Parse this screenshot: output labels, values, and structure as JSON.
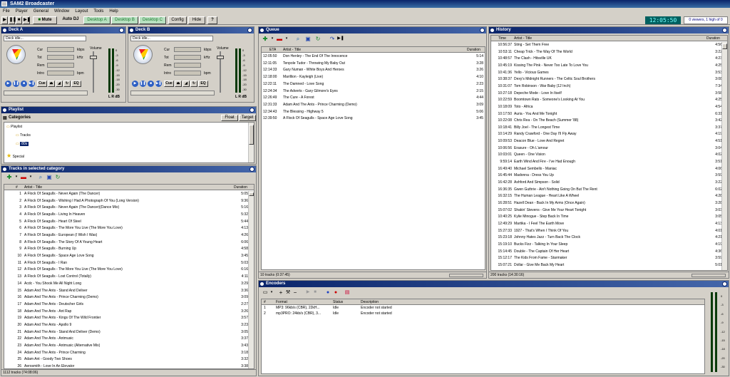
{
  "app": {
    "title": "SAM2 Broadcaster"
  },
  "menu": [
    "File",
    "Player",
    "General",
    "Window",
    "Layout",
    "Tools",
    "Help"
  ],
  "toolbar": {
    "mute": "Mute",
    "autodj": "Auto DJ",
    "desktops": [
      "Desktop A",
      "Desktop B",
      "Desktop C"
    ],
    "config": "Config",
    "hide": "Hide",
    "help": "?",
    "clock": "12:05:50",
    "viewers": "0 viewers, 1 high of 0"
  },
  "deckA": {
    "title": "Deck A",
    "status": "Deck idle...",
    "labels": [
      "Cur",
      "Tot",
      "Rem",
      "Intro"
    ],
    "units": [
      "kbps",
      "kHz",
      "",
      "bpm"
    ],
    "volume": "Volume",
    "cue": "Cue",
    "eq": "EQ",
    "meter_label": "L R dB"
  },
  "deckB": {
    "title": "Deck B",
    "status": "Deck idle...",
    "labels": [
      "Cur",
      "Tot",
      "Rem",
      "Intro"
    ],
    "units": [
      "kbps",
      "kHz",
      "",
      "bpm"
    ],
    "volume": "Volume",
    "cue": "Cue",
    "eq": "EQ",
    "meter_label": "L R dB"
  },
  "meter_scale": [
    "0",
    "-3",
    "-6",
    "-9",
    "-12",
    "-15",
    "-18",
    "-20",
    "-30"
  ],
  "playlist": {
    "title": "Playlist",
    "categories": "Categories",
    "float": "Float",
    "target": "Target",
    "tree": [
      "Playlist",
      "Tracks",
      "80s",
      "Special"
    ]
  },
  "tracks": {
    "title": "Tracks in selected category",
    "headers": {
      "num": "#",
      "title": "Artist - Title",
      "duration": "Duration"
    },
    "rows": [
      [
        "1",
        "A Flock Of Seagulls - Never Again (The Dancer)",
        "5:05"
      ],
      [
        "2",
        "A Flock Of Seagulls - Wishing I Had A Photograph Of You (Long Version)",
        "9:36"
      ],
      [
        "3",
        "A Flock Of Seagulls - Never Again (The Dancer)(Dance Mix)",
        "5:16"
      ],
      [
        "4",
        "A Flock Of Seagulls - Living In Heaven",
        "5:32"
      ],
      [
        "5",
        "A Flock Of Seagulls - Heart Of Steel",
        "5:44"
      ],
      [
        "6",
        "A Flock Of Seagulls - The More You Live (The More You Love)",
        "4:13"
      ],
      [
        "7",
        "A Flock Of Seagulls - European (I Wish I Was)",
        "4:26"
      ],
      [
        "8",
        "A Flock Of Seagulls - The Story Of A Young Heart",
        "6:06"
      ],
      [
        "9",
        "A Flock Of Seagulls - Burning Up",
        "4:58"
      ],
      [
        "10",
        "A Flock Of Seagulls - Space Age Love Song",
        "3:45"
      ],
      [
        "11",
        "A Flock Of Seagulls - I Ran",
        "5:03"
      ],
      [
        "12",
        "A Flock Of Seagulls - The More You Live (The More You Love)",
        "6:16"
      ],
      [
        "13",
        "A Flock Of Seagulls - Lost Control (Totally)",
        "4:11"
      ],
      [
        "14",
        "Acdc - You Shook Me All Night Long",
        "3:29"
      ],
      [
        "15",
        "Adam And The Ants - Stand And Deliver",
        "3:36"
      ],
      [
        "16",
        "Adam And The Ants - Prince Charming (Demo)",
        "3:09"
      ],
      [
        "17",
        "Adam And The Ants - Deutscher Girls",
        "2:27"
      ],
      [
        "18",
        "Adam And The Ants - Ant Rap",
        "3:26"
      ],
      [
        "19",
        "Adam And The Ants - Kings Of The Wild Frontier",
        "3:57"
      ],
      [
        "20",
        "Adam And The Ants - Apollo 9",
        "3:23"
      ],
      [
        "21",
        "Adam And The Ants - Stand And Deliver (Demo)",
        "3:05"
      ],
      [
        "22",
        "Adam And The Ants - Antmusic",
        "3:37"
      ],
      [
        "23",
        "Adam And The Ants - Antmusic (Alternative Mix)",
        "3:43"
      ],
      [
        "24",
        "Adam And The Ants - Prince Charming",
        "3:18"
      ],
      [
        "25",
        "Adam Ant - Goody Two Shoes",
        "3:32"
      ],
      [
        "26",
        "Aerosmith - Love In An Elevator",
        "3:38"
      ]
    ],
    "status": "1112 tracks (74:08:06)"
  },
  "queue": {
    "title": "Queue",
    "headers": {
      "eta": "ETA",
      "title": "Artist - Title",
      "duration": "Duration"
    },
    "rows": [
      [
        "12:05:50",
        "Don Henley - The End Of The Innocence",
        "5:14"
      ],
      [
        "12:11:05",
        "Tenpole Tudor - Throwing My Baby Out",
        "3:28"
      ],
      [
        "12:14:33",
        "Gary Numan - White Boys And Heroes",
        "3:26"
      ],
      [
        "12:18:00",
        "Marillion - Kayleigh (Live)",
        "4:10"
      ],
      [
        "12:22:11",
        "The Damned - Love Song",
        "2:23"
      ],
      [
        "12:24:34",
        "The Adverts - Gary Gilmore's Eyes",
        "2:15"
      ],
      [
        "12:26:49",
        "The Cure - A Forest",
        "4:44"
      ],
      [
        "12:31:33",
        "Adam And The Ants - Prince Charming (Demo)",
        "3:09"
      ],
      [
        "12:34:43",
        "The Blessing - Highway 5",
        "5:06"
      ],
      [
        "12:39:50",
        "A Flock Of Seagulls - Space Age Love Song",
        "3:45"
      ]
    ],
    "status": "10 tracks (0:37:45)"
  },
  "history": {
    "title": "History",
    "headers": {
      "time": "Time",
      "title": "Artist - Title",
      "duration": "Duration"
    },
    "rows": [
      [
        "10:56:37",
        "Sting - Set Them Free",
        "4:56"
      ],
      [
        "10:53:11",
        "Cheap Trick - The Way Of The World",
        "3:22"
      ],
      [
        "10:48:57",
        "The Clash - Hitsville UK",
        "4:23"
      ],
      [
        "10:45:19",
        "Kissing The Pink - Never Too Late To Love You",
        "4:25"
      ],
      [
        "10:41:36",
        "Yello - Vicious Games",
        "3:53"
      ],
      [
        "10:38:37",
        "Dexy's Midnight Runners - The Celtic Soul Brothers",
        "3:08"
      ],
      [
        "10:31:07",
        "Tom Robinson - War Baby (12 Inch)",
        "7:34"
      ],
      [
        "10:27:18",
        "Depeche Mode - Love In Itself",
        "3:58"
      ],
      [
        "10:22:59",
        "Boomtown Rats - Someone's Looking At You",
        "4:25"
      ],
      [
        "10:18:09",
        "Toto - Africa",
        "4:54"
      ],
      [
        "10:17:50",
        "Auria - You And Me Tonight",
        "6:31"
      ],
      [
        "10:22:08",
        "Chris Rea - On The Beach (Summer '88)",
        "3:42"
      ],
      [
        "10:18:41",
        "Billy Joel - The Longest Time",
        "3:37"
      ],
      [
        "10:14:29",
        "Randy Crawford - One Day I'll Fly Away",
        "4:19"
      ],
      [
        "10:09:53",
        "Deacon Blue - Love And Regret",
        "4:51"
      ],
      [
        "10:06:56",
        "Erasure - Oh L'amour",
        "3:04"
      ],
      [
        "10:03:01",
        "Queen - One Vision",
        "4:02"
      ],
      [
        "9:59:14",
        "Earth Wind And Fire - I've Had Enough",
        "3:51"
      ],
      [
        "16:49:40",
        "Michael Sembello - Maniac",
        "4:06"
      ],
      [
        "16:45:44",
        "Madonna - Dress You Up",
        "3:59"
      ],
      [
        "16:42:28",
        "Ashford And Simpson - Solid",
        "3:22"
      ],
      [
        "16:36:35",
        "Gwen Guthrie - Ain't Nothing Going On But The Rent",
        "6:02"
      ],
      [
        "16:32:15",
        "The Human League - Heart Like A Wheel",
        "4:28"
      ],
      [
        "16:28:51",
        "Hazell Dean - Back In My Arms (Once Again)",
        "3:28"
      ],
      [
        "15:07:02",
        "Shakin' Stevens - Give Me Your Heart Tonight",
        "3:03"
      ],
      [
        "10:40:25",
        "Kylie Minogue - Step Back In Time",
        "3:05"
      ],
      [
        "12:49:29",
        "Martika - I Feel The Earth Move",
        "4:13"
      ],
      [
        "15:27:33",
        "1927 - That's When I Think Of You",
        "4:01"
      ],
      [
        "15:23:18",
        "Johnny Hates Jazz - Turn Back The Clock",
        "4:21"
      ],
      [
        "15:19:10",
        "Bucks Fizz - Talking In Your Sleep",
        "4:19"
      ],
      [
        "15:14:45",
        "Double - The Captain Of Her Heart",
        "4:36"
      ],
      [
        "15:12:17",
        "The Kids From Fame - Starmaker",
        "3:59"
      ],
      [
        "15:07:21",
        "Dollar - Give Me Back My Heart",
        "5:01"
      ]
    ],
    "status": "200 tracks (14:30:16)"
  },
  "encoders": {
    "title": "Encoders",
    "headers": {
      "num": "#",
      "format": "Format",
      "status": "Status",
      "description": "Description"
    },
    "rows": [
      [
        "1",
        "MP3: 96kb/s (CBR), 22kH...",
        "Idle",
        "Encoder not started"
      ],
      [
        "2",
        "mp3PRO: 24kb/s (CBR), 3...",
        "Idle",
        "Encoder not started"
      ]
    ]
  }
}
